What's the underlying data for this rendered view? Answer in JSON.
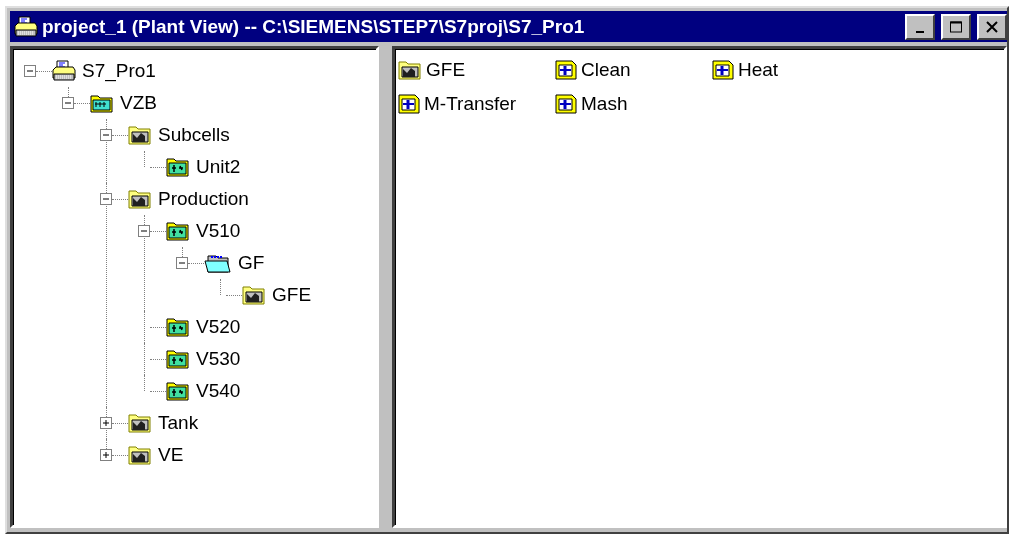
{
  "window": {
    "title": "project_1 (Plant View) -- C:\\SIEMENS\\STEP7\\S7proj\\S7_Pro1"
  },
  "tree": [
    {
      "label": "S7_Pro1",
      "kind": "project",
      "expanded": true,
      "children": [
        {
          "label": "VZB",
          "kind": "plant",
          "expanded": true,
          "children": [
            {
              "label": "Subcells",
              "kind": "area",
              "expanded": true,
              "children": [
                {
                  "label": "Unit2",
                  "kind": "unit"
                }
              ]
            },
            {
              "label": "Production",
              "kind": "area",
              "expanded": true,
              "children": [
                {
                  "label": "V510",
                  "kind": "unit",
                  "expanded": true,
                  "children": [
                    {
                      "label": "GF",
                      "kind": "function",
                      "expanded": true,
                      "children": [
                        {
                          "label": "GFE",
                          "kind": "area"
                        }
                      ]
                    }
                  ]
                },
                {
                  "label": "V520",
                  "kind": "unit"
                },
                {
                  "label": "V530",
                  "kind": "unit"
                },
                {
                  "label": "V540",
                  "kind": "unit"
                }
              ]
            },
            {
              "label": "Tank",
              "kind": "area",
              "expanded": false
            },
            {
              "label": "VE",
              "kind": "area",
              "expanded": false
            }
          ]
        }
      ]
    }
  ],
  "contents": [
    {
      "label": "GFE",
      "kind": "area"
    },
    {
      "label": "Clean",
      "kind": "block"
    },
    {
      "label": "Heat",
      "kind": "block"
    },
    {
      "label": "M-Transfer",
      "kind": "block"
    },
    {
      "label": "Mash",
      "kind": "block"
    }
  ]
}
